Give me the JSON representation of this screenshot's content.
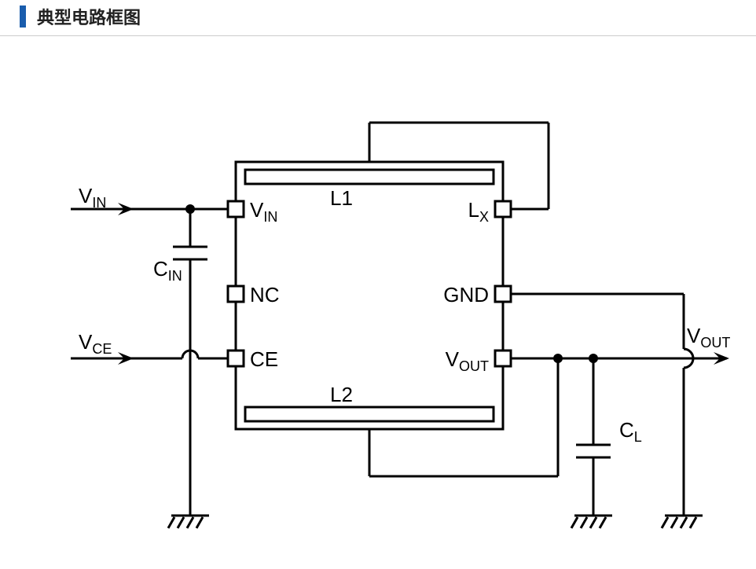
{
  "title": "典型电路框图",
  "inputs": {
    "vin": "V",
    "vin_sub": "IN",
    "vce": "V",
    "vce_sub": "CE"
  },
  "output": {
    "vout": "V",
    "vout_sub": "OUT"
  },
  "caps": {
    "cin": "C",
    "cin_sub": "IN",
    "cl": "C",
    "cl_sub": "L"
  },
  "inductors": {
    "l1": "L1",
    "l2": "L2"
  },
  "pins": {
    "vin": "V",
    "vin_sub": "IN",
    "nc": "NC",
    "ce": "CE",
    "lx": "L",
    "lx_sub": "X",
    "gnd": "GND",
    "vout": "V",
    "vout_sub": "OUT"
  }
}
